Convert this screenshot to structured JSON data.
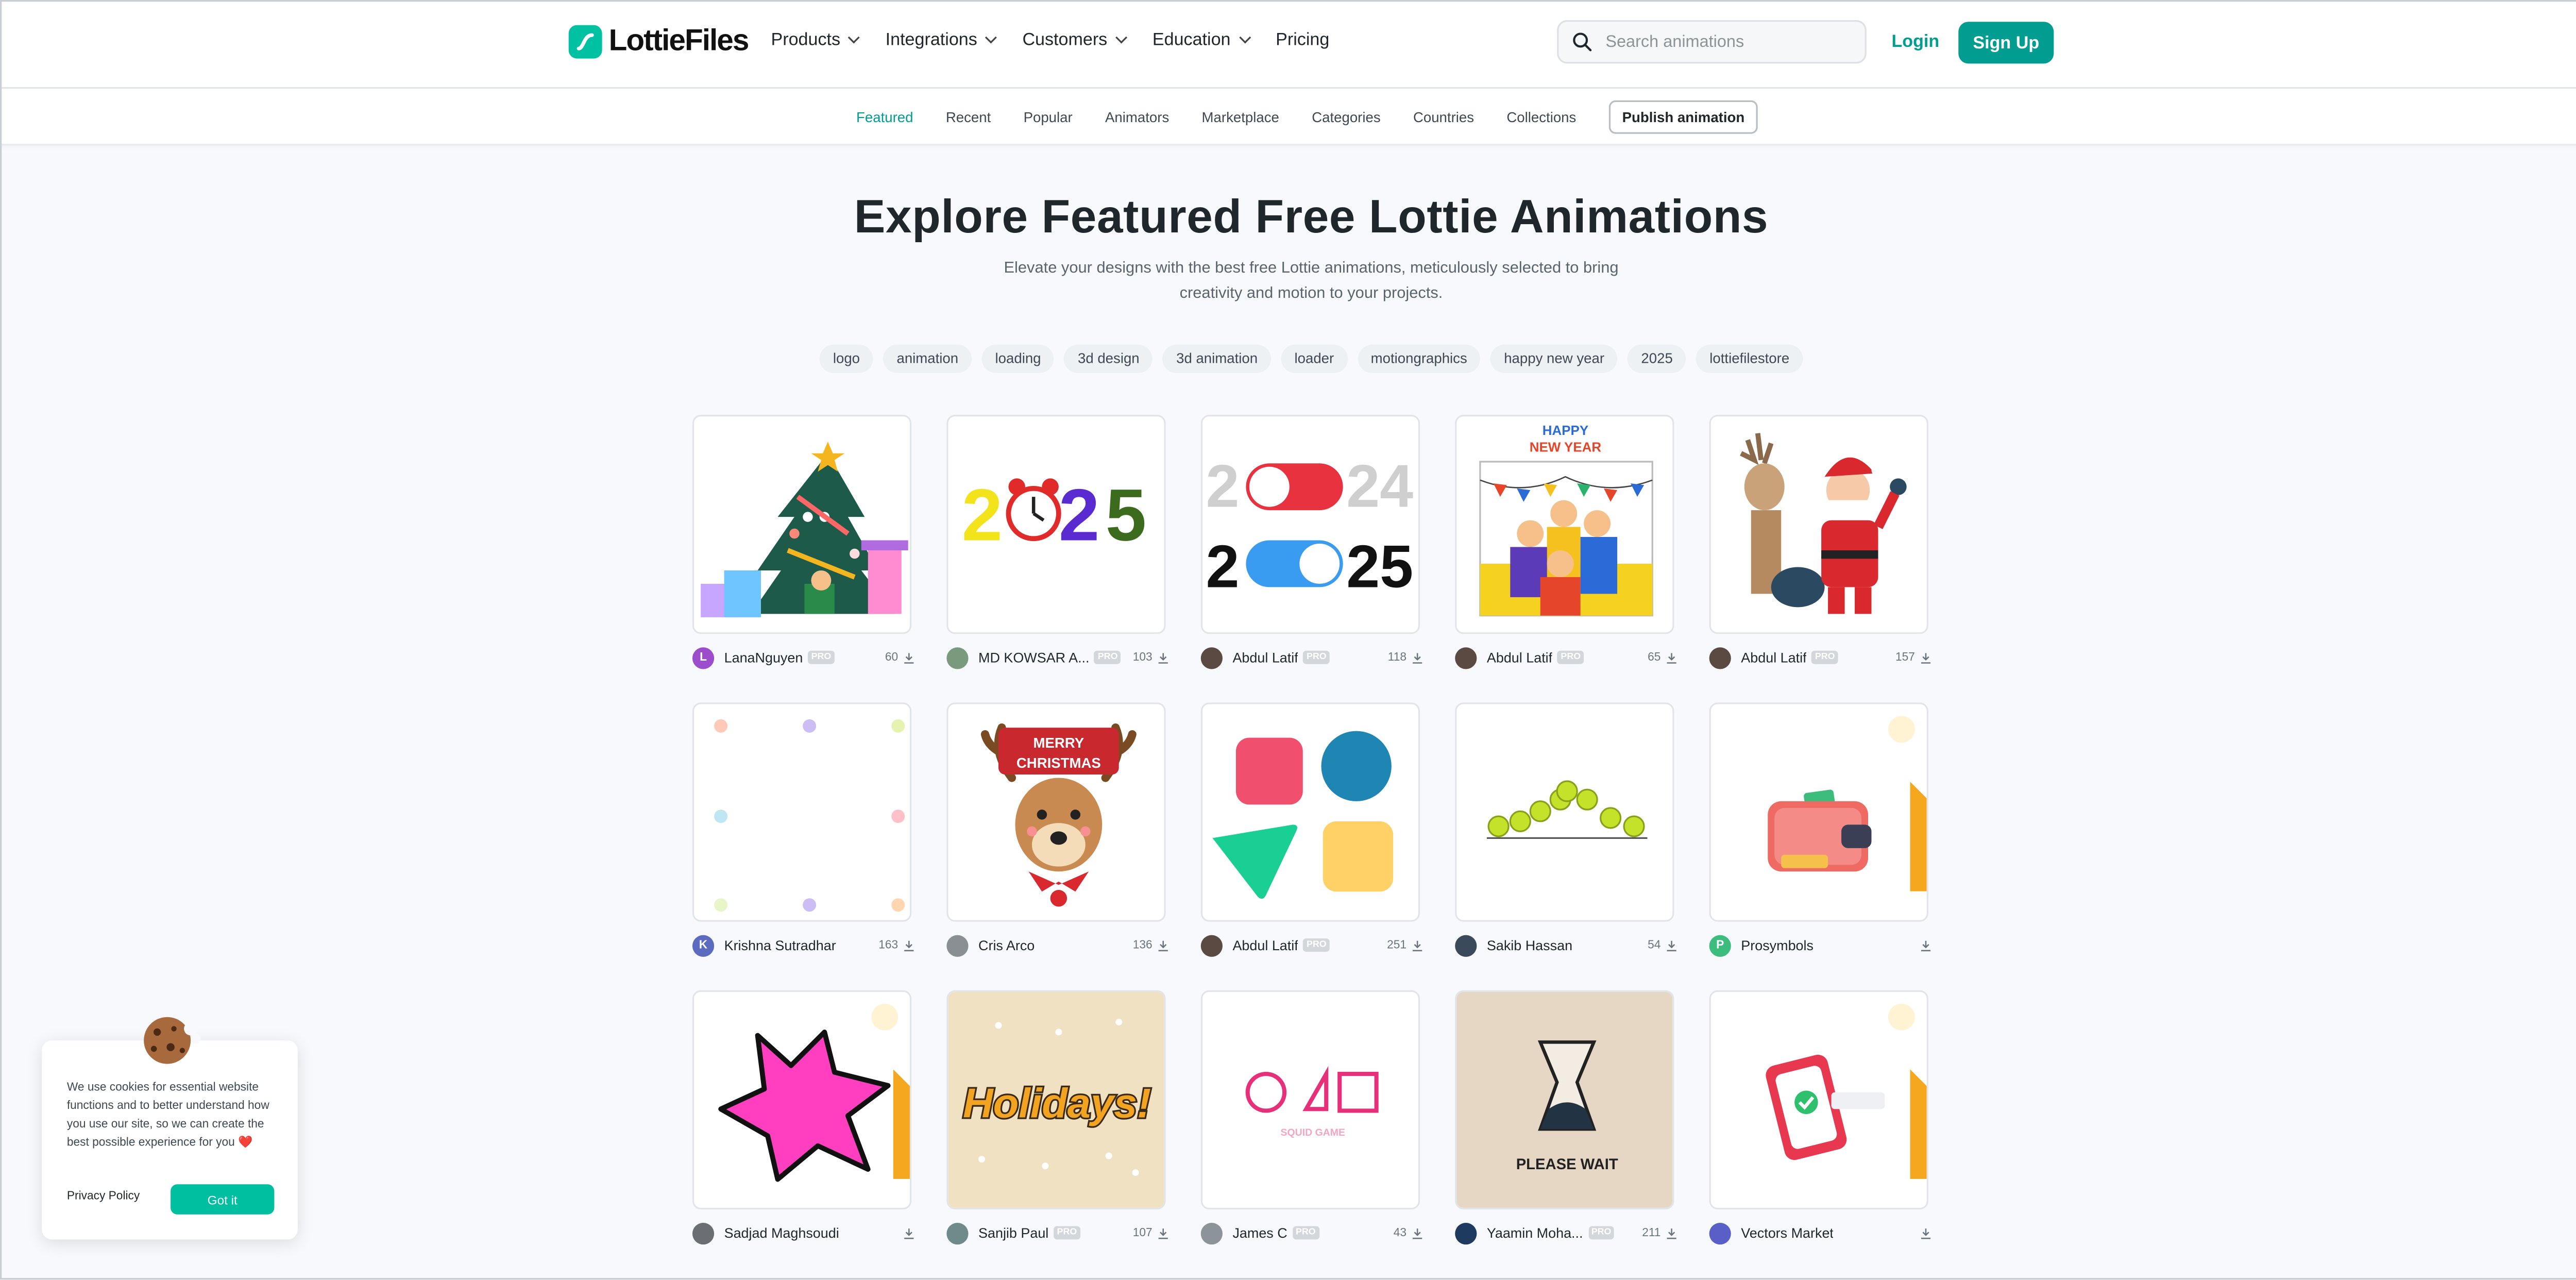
{
  "header": {
    "logo_text": "LottieFiles",
    "nav": [
      {
        "label": "Products",
        "has_dropdown": true
      },
      {
        "label": "Integrations",
        "has_dropdown": true
      },
      {
        "label": "Customers",
        "has_dropdown": true
      },
      {
        "label": "Education",
        "has_dropdown": true
      },
      {
        "label": "Pricing",
        "has_dropdown": false
      }
    ],
    "search_placeholder": "Search animations",
    "login_label": "Login",
    "signup_label": "Sign Up",
    "accent_color": "#019d91"
  },
  "subnav": {
    "items": [
      "Featured",
      "Recent",
      "Popular",
      "Animators",
      "Marketplace",
      "Categories",
      "Countries",
      "Collections"
    ],
    "active": "Featured",
    "publish_label": "Publish animation"
  },
  "hero": {
    "title": "Explore Featured Free Lottie Animations",
    "subtitle": "Elevate your designs with the best free Lottie animations, meticulously selected to bring creativity and motion to your projects."
  },
  "tags": [
    "logo",
    "animation",
    "loading",
    "3d design",
    "3d animation",
    "loader",
    "motiongraphics",
    "happy new year",
    "2025",
    "lottiefilestore"
  ],
  "cards": [
    {
      "art": "christmas-tree",
      "author": "LanaNguyen",
      "pro": true,
      "downloads": "60",
      "avatar_letter": "L",
      "avatar_color": "#9c4dcc"
    },
    {
      "art": "alarm-2025",
      "author": "MD KOWSAR A...",
      "pro": true,
      "downloads": "103",
      "avatar_letter": "",
      "avatar_color": "#7a9a7e"
    },
    {
      "art": "toggle-2025",
      "author": "Abdul Latif",
      "pro": true,
      "downloads": "118",
      "avatar_letter": "",
      "avatar_color": "#5b4a42"
    },
    {
      "art": "happy-new-year",
      "author": "Abdul Latif",
      "pro": true,
      "downloads": "65",
      "avatar_letter": "",
      "avatar_color": "#5b4a42"
    },
    {
      "art": "santa-reindeer",
      "author": "Abdul Latif",
      "pro": true,
      "downloads": "157",
      "avatar_letter": "",
      "avatar_color": "#5b4a42"
    },
    {
      "art": "dots-loader",
      "author": "Krishna Sutradhar",
      "pro": false,
      "downloads": "163",
      "avatar_letter": "K",
      "avatar_color": "#5c6bc0"
    },
    {
      "art": "merry-christmas-reindeer",
      "author": "Cris Arco",
      "pro": false,
      "downloads": "136",
      "avatar_letter": "",
      "avatar_color": "#8a8f94"
    },
    {
      "art": "shapes",
      "author": "Abdul Latif",
      "pro": true,
      "downloads": "251",
      "avatar_letter": "",
      "avatar_color": "#5b4a42"
    },
    {
      "art": "balls-loader",
      "author": "Sakib Hassan",
      "pro": false,
      "downloads": "54",
      "avatar_letter": "",
      "avatar_color": "#3a4a5a"
    },
    {
      "art": "wallet",
      "author": "Prosymbols",
      "pro": false,
      "downloads": "",
      "avatar_letter": "P",
      "avatar_color": "#3dbd7d",
      "premium": true
    },
    {
      "art": "pink-burst",
      "author": "Sadjad Maghsoudi",
      "pro": false,
      "downloads": "",
      "avatar_letter": "",
      "avatar_color": "#6b6f73",
      "premium": true
    },
    {
      "art": "holidays",
      "author": "Sanjib Paul",
      "pro": true,
      "downloads": "107",
      "avatar_letter": "",
      "avatar_color": "#6e8a8a"
    },
    {
      "art": "squid-game",
      "author": "James C",
      "pro": true,
      "downloads": "43",
      "avatar_letter": "",
      "avatar_color": "#8c9399"
    },
    {
      "art": "please-wait",
      "author": "Yaamin Moha...",
      "pro": true,
      "downloads": "211",
      "avatar_letter": "",
      "avatar_color": "#1e3a5f"
    },
    {
      "art": "phone-check",
      "author": "Vectors Market",
      "pro": false,
      "downloads": "",
      "avatar_letter": "",
      "avatar_color": "#5a5fc7",
      "premium": true
    }
  ],
  "card_art_text": {
    "y2025": "2025",
    "y2024_digits": "24",
    "y2025_digits": "25",
    "happy": "HAPPY",
    "new_year": "NEW YEAR",
    "merry": "MERRY",
    "christmas": "CHRISTMAS",
    "holidays": "Holidays!",
    "squid": "SQUID GAME",
    "please_wait": "PLEASE WAIT"
  },
  "pro_badge": "PRO",
  "cookie": {
    "text": "We use cookies for essential website functions and to better understand how you use our site, so we can create the best possible experience for you ❤️",
    "privacy_label": "Privacy Policy",
    "accept_label": "Got it"
  }
}
